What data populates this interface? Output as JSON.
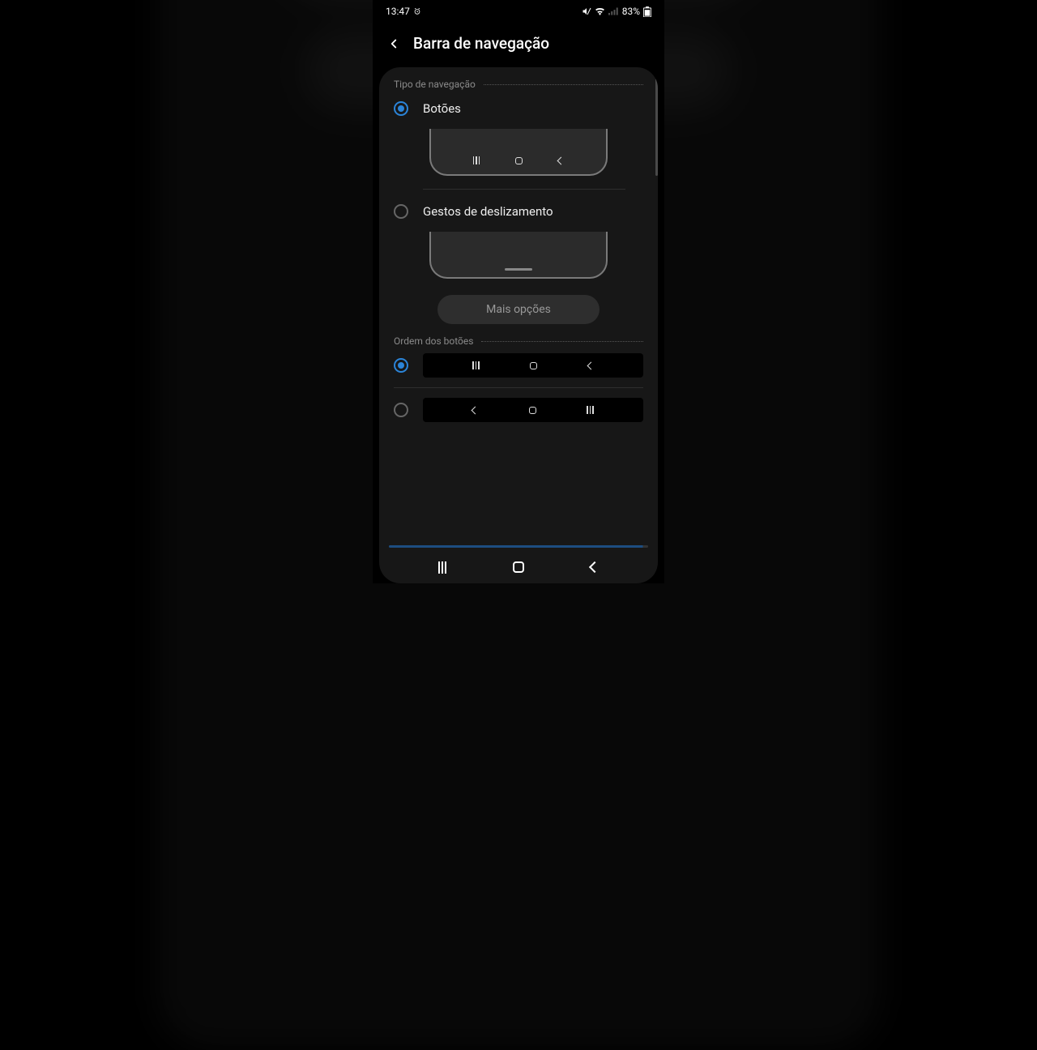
{
  "status": {
    "time": "13:47",
    "battery": "83%"
  },
  "header": {
    "title": "Barra de navegação"
  },
  "sections": {
    "nav_type_label": "Tipo de navegação",
    "option_buttons": "Botões",
    "option_gestures": "Gestos de deslizamento",
    "more_options": "Mais opções",
    "button_order_label": "Ordem dos botões"
  }
}
